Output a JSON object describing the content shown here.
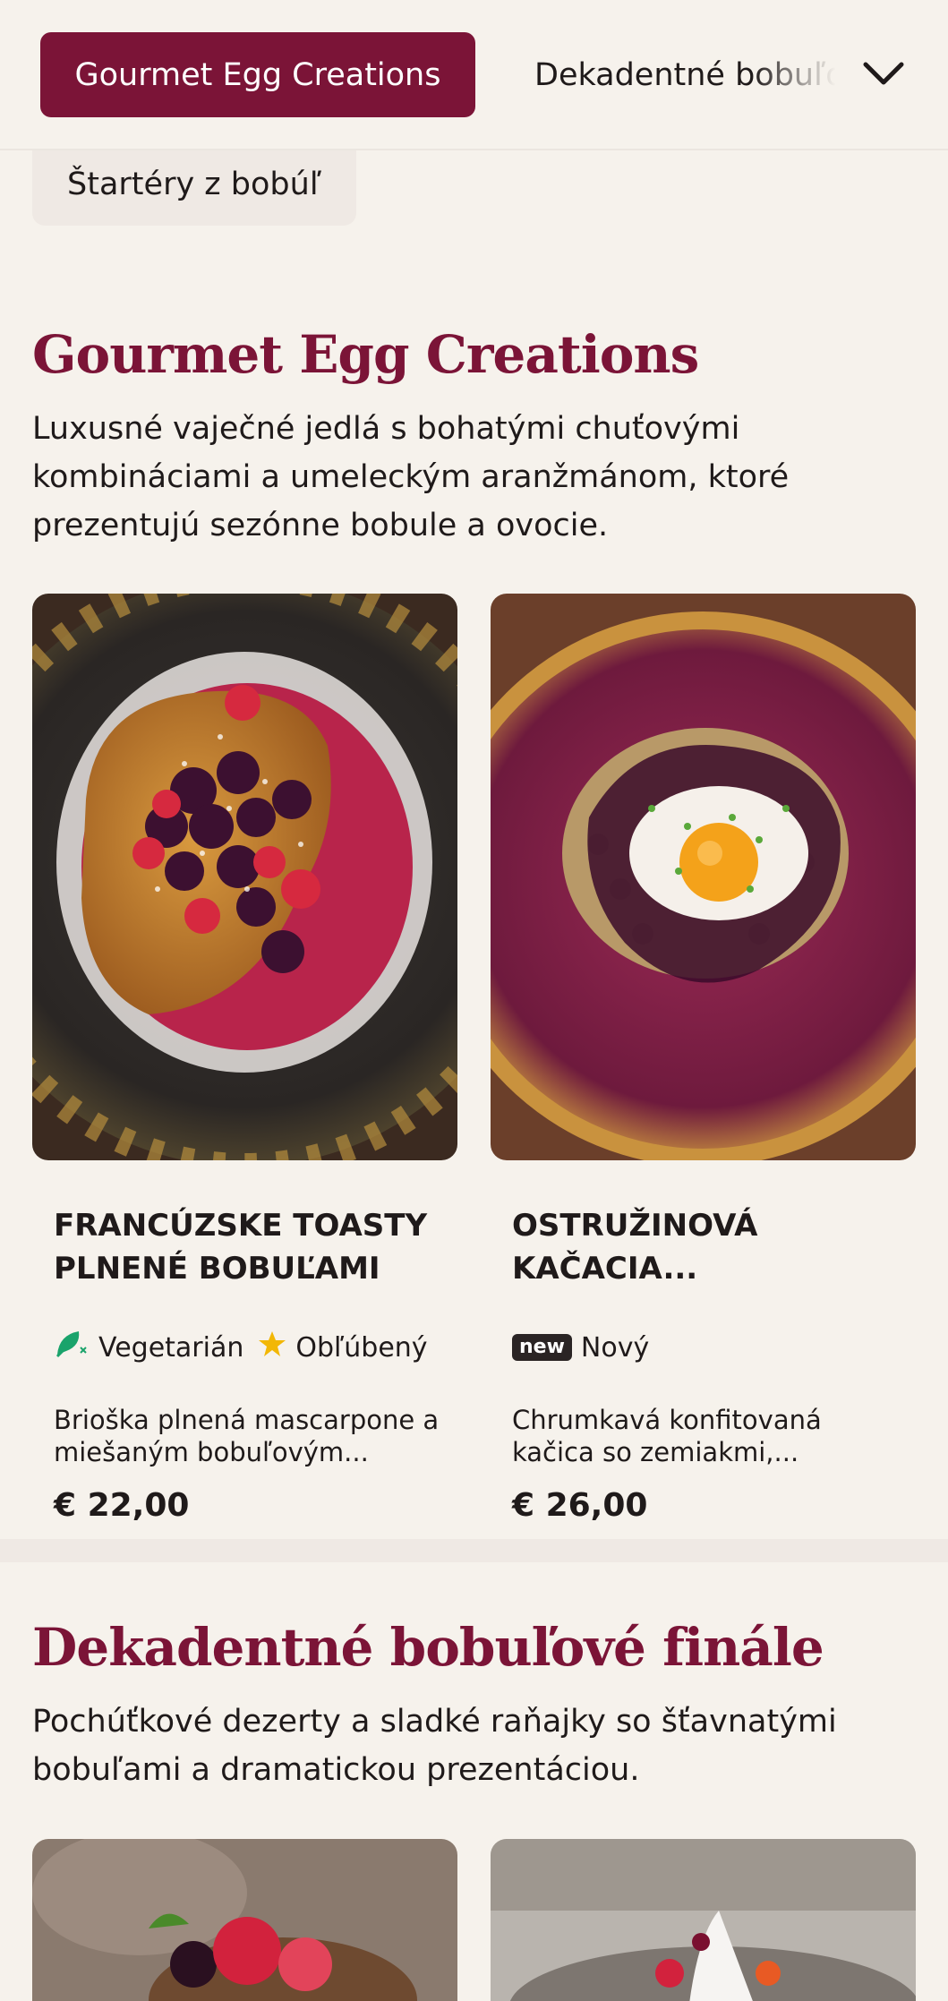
{
  "nav": {
    "active_category": "Gourmet Egg Creations",
    "next_category": "Dekadentné bobuľové finále",
    "prev_category": "Štartéry z bobúľ",
    "expand_icon": "chevron-down-icon"
  },
  "section1": {
    "title": "Gourmet Egg Creations",
    "description": "Luxusné vaječné jedlá s bohatými chuťovými kombináciami a umeleckým aranžmánom, ktoré prezentujú sezónne bobule a ovocie.",
    "items": [
      {
        "title": "FRANCÚZSKE TOASTY PLNENÉ BOBUĽAMI",
        "tags": [
          {
            "icon": "vegetarian-leaf-icon",
            "label": "Vegetarián"
          },
          {
            "icon": "star-icon",
            "label": "Obľúbený"
          }
        ],
        "description": "Brioška plnená mascarpone a miešaným bobuľovým...",
        "price": "€ 22,00"
      },
      {
        "title": "OSTRUŽINOVÁ KAČACIA...",
        "tags": [
          {
            "icon": "new-badge",
            "badge": "new",
            "label": "Nový"
          }
        ],
        "description": "Chrumkavá konfitovaná kačica so zemiakmi,...",
        "price": "€ 26,00"
      }
    ]
  },
  "section2": {
    "title": "Dekadentné bobuľové finále",
    "description": "Pochúťkové dezerty a sladké raňajky so šťavnatými bobuľami a dramatickou prezentáciou."
  },
  "colors": {
    "accent": "#7b1437",
    "background": "#f6f2ec",
    "chip": "#efe9e4",
    "star": "#f2b705",
    "vegetarian": "#1aa36b"
  }
}
